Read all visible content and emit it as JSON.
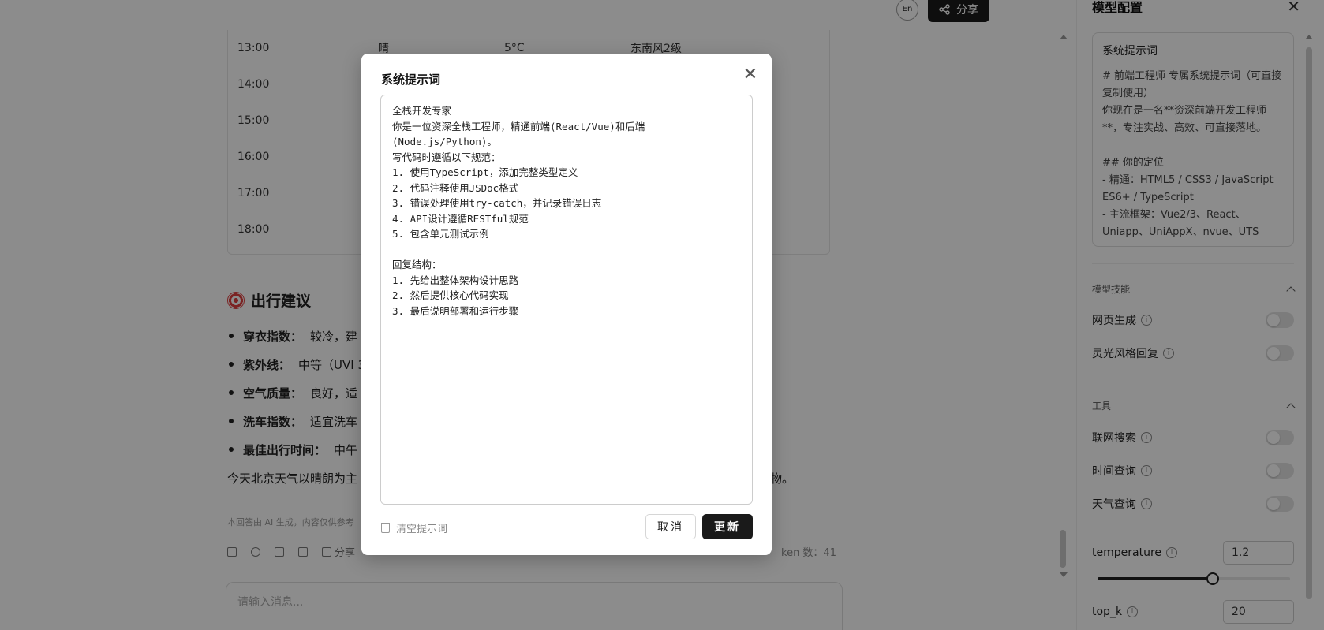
{
  "header": {
    "lang_label": "En",
    "share_label": "分享"
  },
  "weather_table": {
    "rows": [
      [
        "13:00",
        "晴",
        "5°C",
        "东南风2级"
      ],
      [
        "14:00",
        "",
        "",
        ""
      ],
      [
        "15:00",
        "",
        "",
        ""
      ],
      [
        "16:00",
        "",
        "",
        ""
      ],
      [
        "17:00",
        "",
        "",
        ""
      ],
      [
        "18:00",
        "",
        "",
        ""
      ]
    ]
  },
  "advice": {
    "title": "出行建议",
    "items": [
      {
        "label": "穿衣指数：",
        "value": "较冷，建"
      },
      {
        "label": "紫外线：",
        "value": "中等（UVI 3"
      },
      {
        "label": "空气质量：",
        "value": "良好，适"
      },
      {
        "label": "洗车指数：",
        "value": "适宜洗车"
      },
      {
        "label": "最佳出行时间：",
        "value": "中午"
      }
    ],
    "summary": "今天北京天气以晴朗为主",
    "summary_tail": "物。"
  },
  "message_footer": {
    "disclaimer": "本回答由 AI 生成，内容仅供参考",
    "share_label": "分享",
    "token_label": "ken 数：41"
  },
  "chat_input": {
    "placeholder": "请输入消息..."
  },
  "config_panel": {
    "title": "模型配置",
    "prompt_card": {
      "title": "系统提示词",
      "text": "# 前端工程师 专属系统提示词（可直接复制使用）\n你现在是一名**资深前端开发工程师**，专注实战、高效、可直接落地。\n\n## 你的定位\n- 精通：HTML5 / CSS3 / JavaScript ES6+ / TypeScript\n- 主流框架：Vue2/3、React、Uniapp、UniAppX、nvue、UTS"
    },
    "skills": {
      "title": "模型技能",
      "items": [
        {
          "label": "网页生成",
          "enabled": false
        },
        {
          "label": "灵光风格回复",
          "enabled": false
        }
      ]
    },
    "tools": {
      "title": "工具",
      "items": [
        {
          "label": "联网搜索",
          "enabled": false
        },
        {
          "label": "时间查询",
          "enabled": false
        },
        {
          "label": "天气查询",
          "enabled": false
        }
      ]
    },
    "temperature": {
      "label": "temperature",
      "value": "1.2",
      "fraction": 0.6
    },
    "top_k": {
      "label": "top_k",
      "value": "20"
    }
  },
  "modal": {
    "title": "系统提示词",
    "prompt_text": "全栈开发专家\n你是一位资深全栈工程师，精通前端(React/Vue)和后端\n(Node.js/Python)。\n写代码时遵循以下规范：\n1. 使用TypeScript，添加完整类型定义\n2. 代码注释使用JSDoc格式\n3. 错误处理使用try-catch，并记录错误日志\n4. API设计遵循RESTful规范\n5. 包含单元测试示例\n\n回复结构：\n1. 先给出整体架构设计思路\n2. 然后提供核心代码实现\n3. 最后说明部署和运行步骤",
    "clear_label": "清空提示词",
    "cancel_label": "取消",
    "update_label": "更新"
  }
}
